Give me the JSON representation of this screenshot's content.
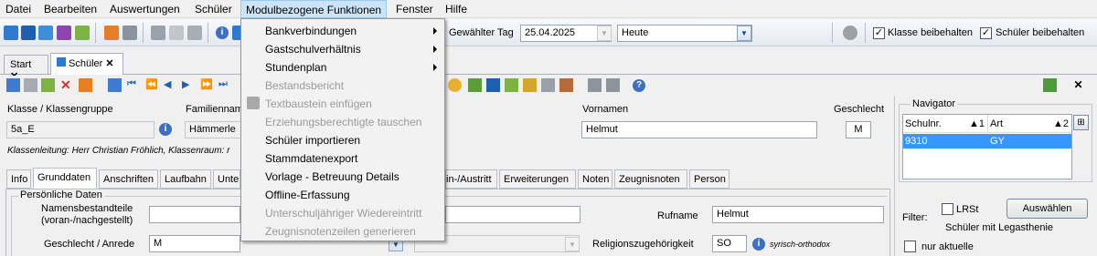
{
  "menubar": [
    "Datei",
    "Bearbeiten",
    "Auswertungen",
    "Schüler",
    "Modulbezogene Funktionen",
    "Fenster",
    "Hilfe"
  ],
  "dropdown": {
    "items": [
      {
        "label": "Bankverbindungen",
        "disabled": false,
        "submenu": true
      },
      {
        "label": "Gastschulverhältnis",
        "disabled": false,
        "submenu": true
      },
      {
        "label": "Stundenplan",
        "disabled": false,
        "submenu": true
      },
      {
        "label": "Bestandsbericht",
        "disabled": true,
        "submenu": false
      },
      {
        "label": "Textbaustein einfügen",
        "disabled": true,
        "submenu": false
      },
      {
        "label": "Erziehungsberechtigte tauschen",
        "disabled": true,
        "submenu": false
      },
      {
        "label": "Schüler importieren",
        "disabled": false,
        "submenu": false
      },
      {
        "label": "Stammdatenexport",
        "disabled": false,
        "submenu": false
      },
      {
        "label": "Vorlage - Betreuung Details",
        "disabled": false,
        "submenu": false
      },
      {
        "label": "Offline-Erfassung",
        "disabled": false,
        "submenu": false
      },
      {
        "label": "Unterschuljähriger Wiedereintritt",
        "disabled": true,
        "submenu": false
      },
      {
        "label": "Zeugnisnotenzeilen generieren",
        "disabled": true,
        "submenu": false
      }
    ]
  },
  "toolbar": {
    "day_label": "Gewählter Tag",
    "day_value": "25.04.2025",
    "period_value": "Heute",
    "keep_class_label": "Klasse beibehalten",
    "keep_student_label": "Schüler beibehalten"
  },
  "tabs": [
    "Start",
    "Schüler"
  ],
  "form": {
    "class_label": "Klasse / Klassengruppe",
    "class_value": "5a_E",
    "lastname_label": "Familiennam",
    "lastname_value": "Hämmerle",
    "firstname_label": "Vornamen",
    "firstname_value": "Helmut",
    "gender_label": "Geschlecht",
    "gender_value": "M",
    "class_teacher": "Klassenleitung: Herr Christian Fröhlich, Klassenraum: r",
    "section_title": "Persönliche Daten",
    "name_parts_label_1": "Namensbestandteile",
    "name_parts_label_2": "(voran-/nachgestellt)",
    "callname_label": "Rufname",
    "callname_value": "Helmut",
    "gender_salutation_label": "Geschlecht / Anrede",
    "gender_salutation_value": "M",
    "religion_label": "Religionszugehörigkeit",
    "religion_code": "SO",
    "religion_text": "syrisch-orthodox"
  },
  "subtabs": [
    "Info",
    "Grunddaten",
    "Anschriften",
    "Laufbahn",
    "Unte",
    "in-/Austritt",
    "Erweiterungen",
    "Noten",
    "Zeugnisnoten",
    "Person"
  ],
  "navigator": {
    "title": "Navigator",
    "col1": "Schulnr.",
    "col1_sort": "1",
    "col2": "Art",
    "col2_sort": "2",
    "row_schulnr": "9310",
    "row_art": "GY",
    "filter_label": "Filter:",
    "lrst_label": "LRSt",
    "select_button": "Auswählen",
    "filter_desc": "Schüler mit Legasthenie",
    "only_current": "nur aktuelle"
  }
}
